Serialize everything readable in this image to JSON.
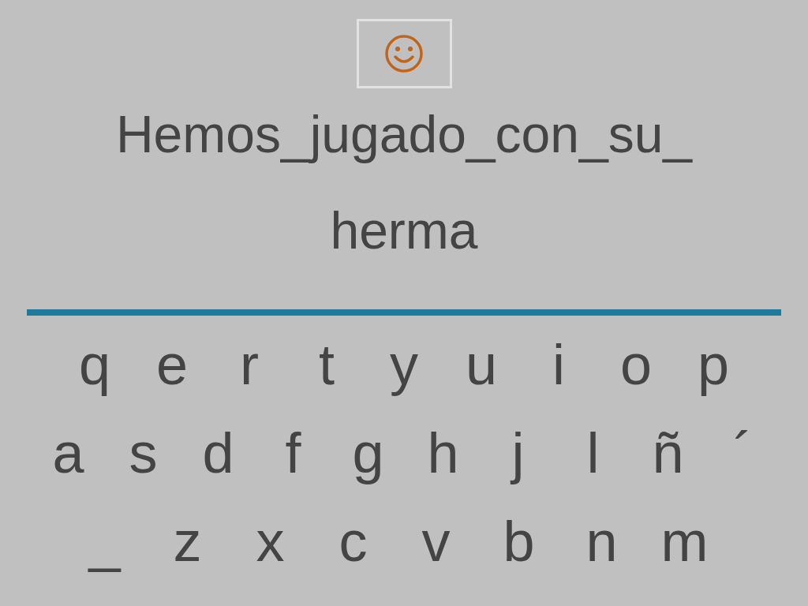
{
  "prompt": {
    "lines": [
      "Hemos_jugado_con_su_",
      "herma"
    ]
  },
  "keyboard": {
    "rows": [
      [
        "q",
        "e",
        "r",
        "t",
        "y",
        "u",
        "i",
        "o",
        "p"
      ],
      [
        "a",
        "s",
        "d",
        "f",
        "g",
        "h",
        "j",
        "l",
        "ñ",
        "´"
      ],
      [
        "_",
        "z",
        "x",
        "c",
        "v",
        "b",
        "n",
        "m"
      ]
    ]
  }
}
